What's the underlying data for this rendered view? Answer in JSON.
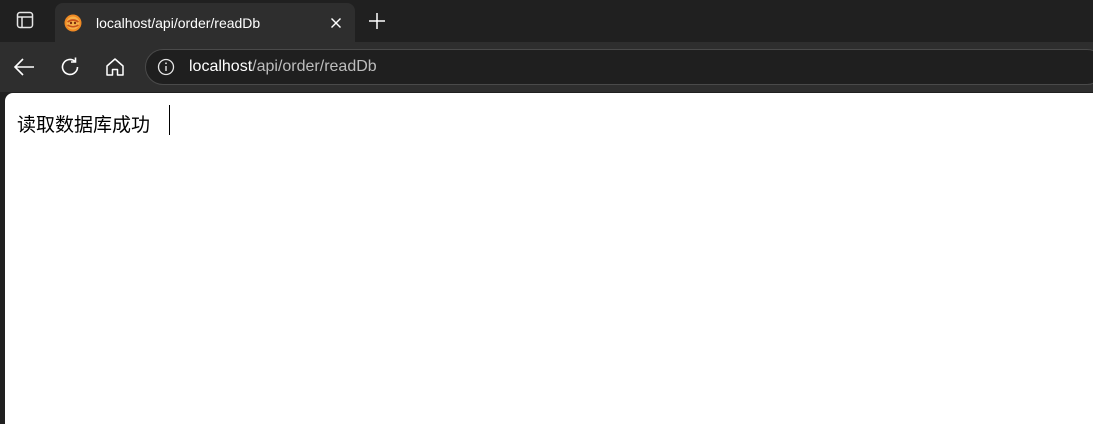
{
  "browser": {
    "tab": {
      "title": "localhost/api/order/readDb",
      "favicon": "brand-favicon-icon",
      "close_icon": "close-icon"
    },
    "new_tab_icon": "plus-icon",
    "sidebar_icon": "sidebar-toggle-icon",
    "toolbar": {
      "back_icon": "back-arrow-icon",
      "reload_icon": "reload-icon",
      "home_icon": "home-icon"
    },
    "address_bar": {
      "info_icon": "info-icon",
      "url_host": "localhost",
      "url_path": "/api/order/readDb"
    }
  },
  "page": {
    "message": "读取数据库成功"
  },
  "colors": {
    "frame": "#202020",
    "toolbar": "#2e2e2e",
    "content": "#ffffff",
    "favicon_orange": "#f08a24"
  }
}
